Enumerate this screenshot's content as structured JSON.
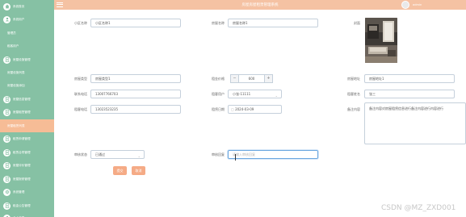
{
  "header": {
    "title": "房屋房屋租赁管理系统",
    "user_name": "admin"
  },
  "sidebar": {
    "items": [
      {
        "label": "系统首页",
        "icon": "home-icon",
        "sub": false,
        "active": false
      },
      {
        "label": "系统用户",
        "icon": "user-icon",
        "sub": false,
        "active": false
      },
      {
        "label": "管理员",
        "icon": "",
        "sub": true,
        "active": false
      },
      {
        "label": "租客用户",
        "icon": "",
        "sub": true,
        "active": false
      },
      {
        "label": "房屋设施管理",
        "icon": "doc-icon",
        "sub": false,
        "active": false
      },
      {
        "label": "房屋设施列表",
        "icon": "",
        "sub": true,
        "active": false
      },
      {
        "label": "房屋设施添加",
        "icon": "",
        "sub": true,
        "active": false
      },
      {
        "label": "房屋信息管理",
        "icon": "doc-icon",
        "sub": false,
        "active": false
      },
      {
        "label": "房屋租赁管理",
        "icon": "doc-icon",
        "sub": false,
        "active": false
      },
      {
        "label": "房屋租赁列表",
        "icon": "",
        "sub": true,
        "active": true
      },
      {
        "label": "租赁申请管理",
        "icon": "doc-icon",
        "sub": false,
        "active": false
      },
      {
        "label": "租赁合同管理",
        "icon": "doc-icon",
        "sub": false,
        "active": false
      },
      {
        "label": "房屋评价管理",
        "icon": "doc-icon",
        "sub": false,
        "active": false
      },
      {
        "label": "房屋报修管理",
        "icon": "doc-icon",
        "sub": false,
        "active": false
      },
      {
        "label": "系统管理",
        "icon": "gear-icon",
        "sub": false,
        "active": false
      },
      {
        "label": "租金公告管理",
        "icon": "doc-icon",
        "sub": false,
        "active": false
      },
      {
        "label": "个人信息",
        "icon": "user-icon",
        "sub": false,
        "active": false
      }
    ]
  },
  "form": {
    "community_label": "小区名称",
    "community_value": "小区名称1",
    "house_name_label": "房屋名称",
    "house_name_value": "房屋名称1",
    "cover_label": "封面",
    "house_type_label": "房屋类型",
    "house_type_value": "房屋类型1",
    "rent_price_label": "租金价格",
    "rent_price_value": "600",
    "house_address_label": "房屋地址",
    "house_address_value": "房屋地址1",
    "contact_phone_label": "联系电话",
    "contact_phone_value": "13007766703",
    "tenant_user_label": "租客用户",
    "tenant_user_value": "小张-11111",
    "tenant_name_label": "租客姓名",
    "tenant_name_value": "张三",
    "tenant_phone_label": "租客电话",
    "tenant_phone_value": "13023523235",
    "rent_date_label": "租赁日期",
    "rent_date_value": "2024-03-09",
    "notes_label": "备注内容",
    "notes_value": "备注内容对房屋租赁信息进行备注内容进行内容进行",
    "review_status_label": "审核状态",
    "review_status_value": "已通过",
    "review_reply_label": "审核回复",
    "review_reply_placeholder": "请输入审核回复"
  },
  "buttons": {
    "submit": "提交",
    "cancel": "取消"
  },
  "watermark": "CSDN @MZ_ZXD001",
  "colors": {
    "sidebar": "#86c1a4",
    "header": "#f5c2a3",
    "accent": "#f5ab86",
    "active_item": "#f6bc96"
  }
}
